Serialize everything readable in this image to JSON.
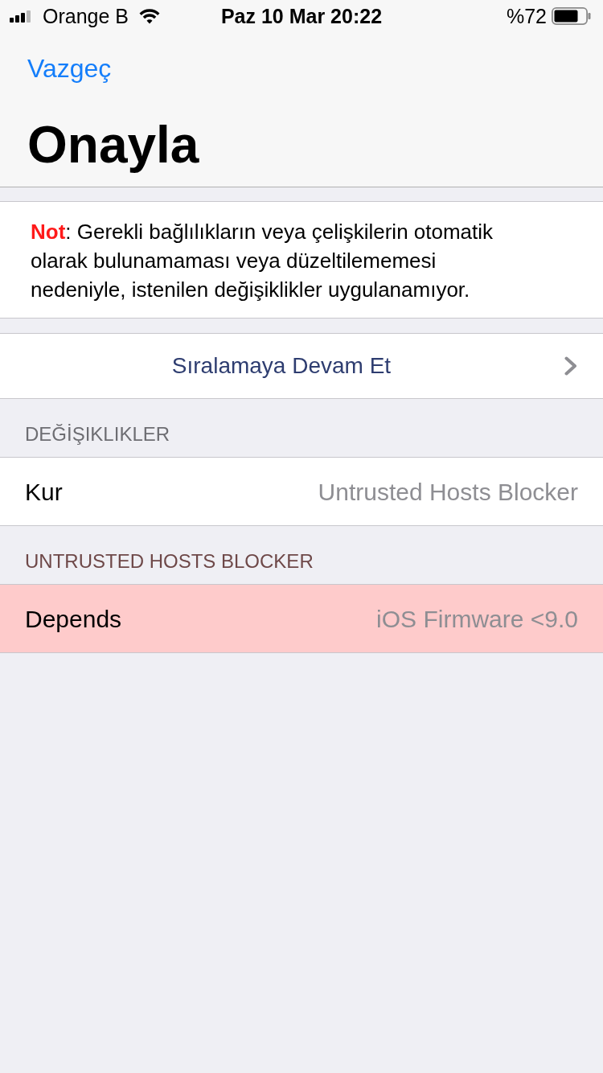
{
  "status_bar": {
    "carrier": "Orange B",
    "time": "Paz 10 Mar 20:22",
    "battery": "%72"
  },
  "navigation": {
    "cancel": "Vazgeç",
    "title": "Onayla"
  },
  "note": {
    "text": "**Not**: Gerekli bağlılıkların veya çelişkilerin otomatik olarak bulunamaması veya düzeltilememesi nedeniyle, istenilen değişiklikler uygulanamıyor."
  },
  "action": {
    "label": "Sıralamaya Devam Et"
  },
  "sections": [
    {
      "header": "DEĞİŞIKLIKLER",
      "error": false,
      "rows": [
        {
          "label": "Kur",
          "value": "Untrusted Hosts Blocker",
          "error": false
        }
      ]
    },
    {
      "header": "UNTRUSTED HOSTS BLOCKER",
      "error": true,
      "rows": [
        {
          "label": "Depends",
          "value": "iOS Firmware <9.0",
          "error": true
        }
      ]
    }
  ]
}
